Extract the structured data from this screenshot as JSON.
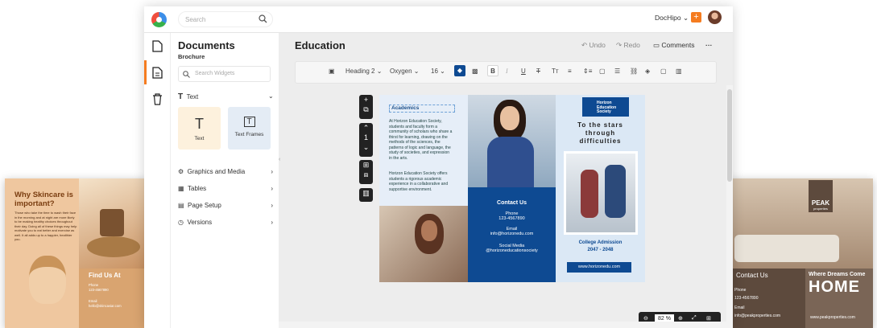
{
  "topbar": {
    "search_placeholder": "Search",
    "account": "DocHipo",
    "plus": "+"
  },
  "panel": {
    "title": "Documents",
    "subtitle": "Brochure",
    "widget_search_placeholder": "Search Widgets",
    "text_section": "Text",
    "cards": [
      {
        "label": "Text",
        "glyph": "T"
      },
      {
        "label": "Text Frames",
        "glyph": "T"
      }
    ],
    "sections": [
      "Graphics and Media",
      "Tables",
      "Page Setup",
      "Versions"
    ]
  },
  "editor": {
    "title": "Education",
    "undo": "Undo",
    "redo": "Redo",
    "comments": "Comments",
    "more": "···"
  },
  "toolbar": {
    "style": "Heading 2",
    "font": "Oxygen",
    "size": "16"
  },
  "page_tools": {
    "page_number": "1"
  },
  "brochure": {
    "academics_heading": "Academics",
    "para1": "At Horizon Education Society, students and faculty form a community of scholars who share a thirst for learning, drawing on the methods of the sciences, the patterns of logic and language, the study of societies, and expression in the arts.",
    "para2": "Horizon Education Society offers students a rigorous academic experience in a collaborative and supportive environment.",
    "contact_heading": "Contact Us",
    "phone_label": "Phone",
    "phone": "123-4567890",
    "email_label": "Email",
    "email": "info@horizonedu.com",
    "social_label": "Social Media",
    "social": "@horizoneducationsociety",
    "badge": "Horizon Education Society",
    "tagline": "To the stars through difficulties",
    "admission": "College Admission",
    "years": "2047 - 2048",
    "website": "www.horizonedu.com"
  },
  "zoom": {
    "value": "82",
    "unit": "%"
  },
  "skincare": {
    "title": "Why Skincare is important?",
    "body": "Those who take the time to wash their face in the morning and at night are more likely to be making healthy choices throughout their day. Doing all of these things may help motivate you to eat better and exercise as well. It all adds up to a happier, healthier you.",
    "find": "Find Us At",
    "phone_label": "Phone",
    "phone": "123-4567890",
    "email_label": "Email",
    "email": "hello@skincaviar.com"
  },
  "peak": {
    "logo": "PEAK",
    "logo_sub": "properties",
    "contact": "Contact Us",
    "phone_label": "Phone",
    "phone": "123-4567890",
    "email_label": "Email",
    "email": "info@peakproperties.com",
    "tag": "Where Dreams Come",
    "home": "HOME",
    "site": "www.peakproperties.com"
  },
  "colors": {
    "accent": "#f57c20",
    "navy": "#0e4a92"
  }
}
